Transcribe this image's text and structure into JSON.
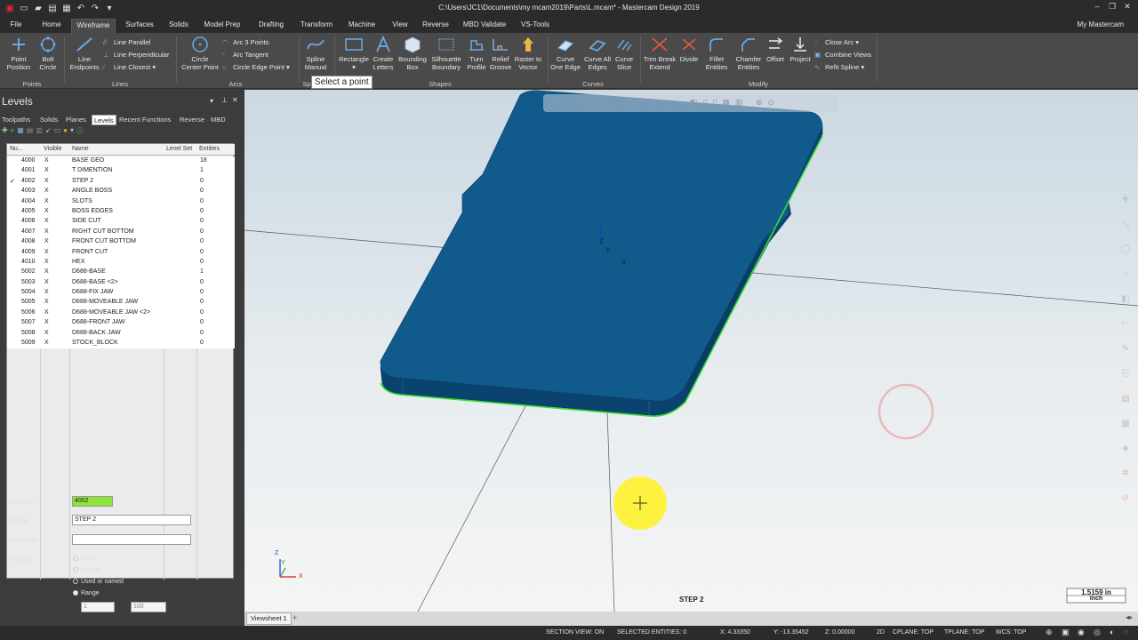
{
  "window": {
    "title": "C:\\Users\\JC1\\Documents\\my mcam2019\\Parts\\L.mcam* - Mastercam Design 2019",
    "account": "My Mastercam"
  },
  "menu": {
    "tabs": [
      "File",
      "Home",
      "Wireframe",
      "Surfaces",
      "Solids",
      "Model Prep",
      "Drafting",
      "Transform",
      "Machine",
      "View",
      "Reverse",
      "MBD Validate",
      "VS-Tools"
    ],
    "active": "Wireframe"
  },
  "ribbon": {
    "point_position": "Point\nPosition",
    "bolt_circle": "Bolt\nCircle",
    "line_endpoints": "Line\nEndpoints",
    "line_parallel": "Line Parallel",
    "line_perpendicular": "Line Perpendicular",
    "line_closest": "Line Closest",
    "circle_center_point": "Circle\nCenter Point",
    "arc_3_points": "Arc 3 Points",
    "arc_tangent": "Arc Tangent",
    "circle_edge_point": "Circle Edge Point",
    "spline_manual": "Spline\nManual",
    "rectangle": "Rectangle",
    "create_letters": "Create\nLetters",
    "bounding_box": "Bounding\nBox",
    "silhouette_boundary": "Silhouette\nBoundary",
    "turn_profile": "Turn\nProfile",
    "relief_groove": "Relief\nGroove",
    "raster_to_vector": "Raster to\nVector",
    "curve_one_edge": "Curve\nOne Edge",
    "curve_all_edges": "Curve All\nEdges",
    "curve_slice": "Curve\nSlice",
    "trim_break_extend": "Trim Break\nExtend",
    "divide": "Divide",
    "fillet_entities": "Fillet\nEntities",
    "chamfer_entities": "Chamfer\nEntities",
    "offset": "Offset",
    "project": "Project",
    "close_arc": "Close Arc",
    "combine_views": "Combine Views",
    "refit_spline": "Refit Spline",
    "groups": {
      "points": "Points",
      "lines": "Lines",
      "arcs": "Arcs",
      "splines": "Sp",
      "shapes": "Shapes",
      "curves": "Curves",
      "modify": "Modify"
    },
    "tooltip": "Select a point"
  },
  "levels_panel": {
    "title": "Levels",
    "tabs": [
      "Toolpaths",
      "Solids",
      "Planes",
      "Levels",
      "Recent Functions",
      "Reverse",
      "MBD"
    ],
    "active_tab": "Levels",
    "columns": [
      "Nu...",
      "Visible",
      "Name",
      "Level Set",
      "Entities"
    ],
    "rows": [
      {
        "number": "4000",
        "visible": "X",
        "name": "BASE GEO",
        "entities": "18",
        "active": false
      },
      {
        "number": "4001",
        "visible": "X",
        "name": "T DIMENTION",
        "entities": "1",
        "active": false
      },
      {
        "number": "4002",
        "visible": "X",
        "name": "STEP 2",
        "entities": "0",
        "active": true
      },
      {
        "number": "4003",
        "visible": "X",
        "name": "ANGLE BOSS",
        "entities": "0",
        "active": false
      },
      {
        "number": "4004",
        "visible": "X",
        "name": "SLOTS",
        "entities": "0",
        "active": false
      },
      {
        "number": "4005",
        "visible": "X",
        "name": "BOSS EDGES",
        "entities": "0",
        "active": false
      },
      {
        "number": "4006",
        "visible": "X",
        "name": "SIDE CUT",
        "entities": "0",
        "active": false
      },
      {
        "number": "4007",
        "visible": "X",
        "name": "RIGHT CUT BOTTOM",
        "entities": "0",
        "active": false
      },
      {
        "number": "4008",
        "visible": "X",
        "name": "FRONT CUT BOTTOM",
        "entities": "0",
        "active": false
      },
      {
        "number": "4009",
        "visible": "X",
        "name": "FRONT CUT",
        "entities": "0",
        "active": false
      },
      {
        "number": "4010",
        "visible": "X",
        "name": "HEX",
        "entities": "0",
        "active": false
      },
      {
        "number": "5002",
        "visible": "X",
        "name": "D688-BASE",
        "entities": "1",
        "active": false
      },
      {
        "number": "5003",
        "visible": "X",
        "name": "D688-BASE <2>",
        "entities": "0",
        "active": false
      },
      {
        "number": "5004",
        "visible": "X",
        "name": "D688-FIX JAW",
        "entities": "0",
        "active": false
      },
      {
        "number": "5005",
        "visible": "X",
        "name": "D688-MOVEABLE JAW",
        "entities": "0",
        "active": false
      },
      {
        "number": "5006",
        "visible": "X",
        "name": "D688-MOVEABLE JAW <2>",
        "entities": "0",
        "active": false
      },
      {
        "number": "5007",
        "visible": "X",
        "name": "D688-FRONT JAW",
        "entities": "0",
        "active": false
      },
      {
        "number": "5008",
        "visible": "X",
        "name": "D688-BACK JAW",
        "entities": "0",
        "active": false
      },
      {
        "number": "5009",
        "visible": "X",
        "name": "STOCK_BLOCK",
        "entities": "0",
        "active": false
      }
    ],
    "form": {
      "number_label": "Number:",
      "number_value": "4002",
      "name_label": "Name:",
      "name_value": "STEP 2",
      "level_set_label": "Level set:",
      "level_set_value": "",
      "display_label": "Display:",
      "display_options": [
        "Used",
        "Named",
        "Used or named",
        "Range"
      ],
      "display_selected": "Range",
      "range_from": "1",
      "range_to": "100"
    }
  },
  "viewport": {
    "autocursor_label": "AutoCursor",
    "axis_z": "Z",
    "axis_y": "Y",
    "axis_x": "X",
    "level_label": "STEP 2",
    "scale_value": "1.5159 in",
    "scale_unit": "Inch",
    "part_color": "#105a8c",
    "part_edge_color": "#33dd33",
    "viewsheet_tab": "Viewsheet 1"
  },
  "status": {
    "section_view": "SECTION VIEW: ON",
    "selected_entities": "SELECTED ENTITIES: 0",
    "x": "X: 4.33350",
    "y": "Y: -13.35452",
    "z": "Z: 0.00000",
    "mode": "2D",
    "cplane": "CPLANE: TOP",
    "tplane": "TPLANE: TOP",
    "wcs": "WCS: TOP"
  }
}
